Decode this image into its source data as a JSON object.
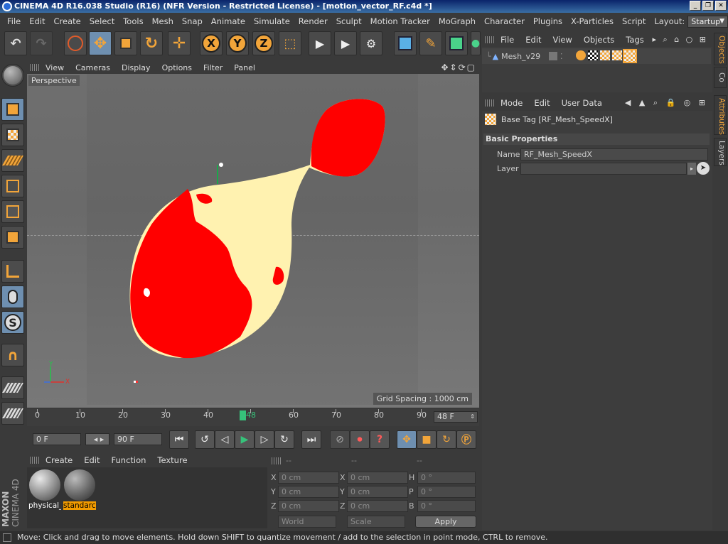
{
  "window": {
    "title": "CINEMA 4D R16.038 Studio (R16) (NFR Version - Restricted License) - [motion_vector_RF.c4d *]",
    "buttons": [
      "_",
      "❐",
      "✕"
    ]
  },
  "menubar": {
    "items": [
      "File",
      "Edit",
      "Create",
      "Select",
      "Tools",
      "Mesh",
      "Snap",
      "Animate",
      "Simulate",
      "Render",
      "Sculpt",
      "Motion Tracker",
      "MoGraph",
      "Character",
      "Plugins",
      "X-Particles",
      "Script"
    ],
    "layout_label": "Layout:",
    "layout_value": "Startup"
  },
  "toolbar": {
    "axis_x": "X",
    "axis_y": "Y",
    "axis_z": "Z"
  },
  "viewport": {
    "menu": [
      "View",
      "Cameras",
      "Display",
      "Options",
      "Filter",
      "Panel"
    ],
    "camera_label": "Perspective",
    "grid_spacing": "Grid Spacing : 1000 cm",
    "axis_y": "Y",
    "axis_x": "X"
  },
  "timeline": {
    "ticks": [
      "0",
      "10",
      "20",
      "30",
      "40",
      "50",
      "60",
      "70",
      "80",
      "90"
    ],
    "playhead": "48",
    "current_frame": "48 F"
  },
  "transport": {
    "start_frame": "0 F",
    "end_frame": "90 F"
  },
  "material_manager": {
    "menu": [
      "Create",
      "Edit",
      "Function",
      "Texture"
    ],
    "materials": [
      {
        "label": "physical_",
        "selected": false
      },
      {
        "label": "standarc",
        "selected": true
      }
    ]
  },
  "coordinates": {
    "headers": [
      "--",
      "--",
      "--"
    ],
    "rows": [
      {
        "l1": "X",
        "v1": "0 cm",
        "l2": "X",
        "v2": "0 cm",
        "l3": "H",
        "v3": "0 °"
      },
      {
        "l1": "Y",
        "v1": "0 cm",
        "l2": "Y",
        "v2": "0 cm",
        "l3": "P",
        "v3": "0 °"
      },
      {
        "l1": "Z",
        "v1": "0 cm",
        "l2": "Z",
        "v2": "0 cm",
        "l3": "B",
        "v3": "0 °"
      }
    ],
    "mode_world": "World",
    "mode_scale": "Scale",
    "apply": "Apply"
  },
  "object_manager": {
    "menu": [
      "File",
      "Edit",
      "View",
      "Objects",
      "Tags"
    ],
    "object_name": "Mesh_v29"
  },
  "attribute_manager": {
    "menu": [
      "Mode",
      "Edit",
      "User Data"
    ],
    "header": "Base Tag [RF_Mesh_SpeedX]",
    "section": "Basic Properties",
    "name_label": "Name",
    "name_value": "RF_Mesh_SpeedX",
    "layer_label": "Layer"
  },
  "side_tabs": {
    "objects": "Objects",
    "content": "Co",
    "attributes": "Attributes",
    "layers": "Layers"
  },
  "brand": {
    "maxon": "MAXON",
    "cinema": "CINEMA 4D"
  },
  "statusbar": {
    "text": "Move: Click and drag to move elements. Hold down SHIFT to quantize movement / add to the selection in point mode, CTRL to remove."
  },
  "colors": {
    "accent": "#f2a53a",
    "mesh_red": "#ff0000",
    "mesh_cream": "#fff2b0",
    "playhead": "#36c27a",
    "selection": "#f39c00"
  }
}
